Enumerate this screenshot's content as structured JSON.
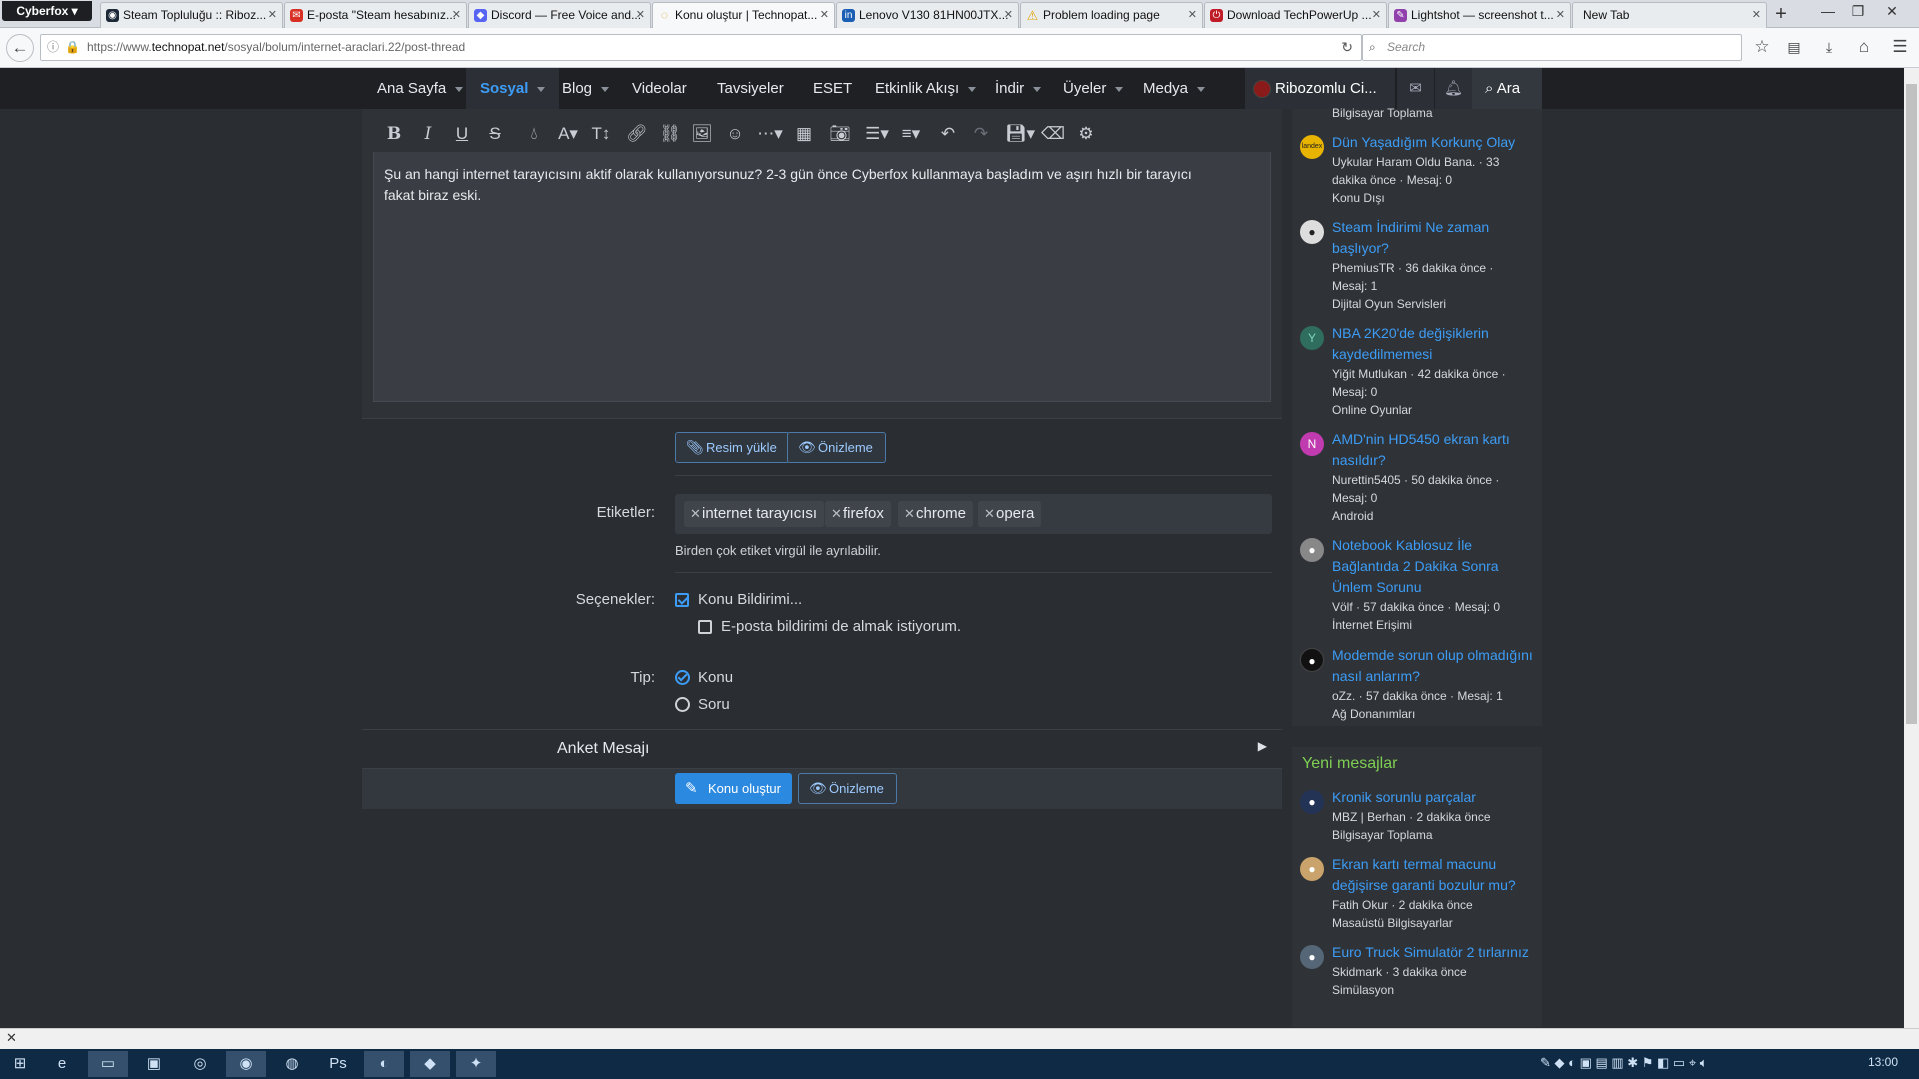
{
  "browser": {
    "app_menu": "Cyberfox",
    "tabs": [
      {
        "title": "Steam Topluluğu :: Riboz...",
        "icon": "steam-icon",
        "color": "#1b2838"
      },
      {
        "title": "E-posta \"Steam hesabınız...",
        "icon": "mail-icon",
        "color": "#d93025"
      },
      {
        "title": "Discord — Free Voice and...",
        "icon": "discord-icon",
        "color": "#5865f2"
      },
      {
        "title": "Konu oluştur | Technopat...",
        "icon": "loading-icon",
        "color": "#e0a020"
      },
      {
        "title": "Lenovo V130 81HN00JTX...",
        "icon": "lenovo-icon",
        "color": "#1a5fb4"
      },
      {
        "title": "Problem loading page",
        "icon": "warning-icon",
        "color": "#e5a50a"
      },
      {
        "title": "Download TechPowerUp ...",
        "icon": "techpowerup-icon",
        "color": "#c01c28"
      },
      {
        "title": "Lightshot — screenshot t...",
        "icon": "lightshot-icon",
        "color": "#9141ac"
      },
      {
        "title": "New Tab",
        "icon": "",
        "color": ""
      }
    ],
    "url_prefix": "https://www.",
    "url_domain": "technopat.net",
    "url_path": "/sosyal/bolum/internet-araclari.22/post-thread",
    "search_placeholder": "Search"
  },
  "site": {
    "nav": [
      {
        "label": "Ana Sayfa",
        "caret": true
      },
      {
        "label": "Sosyal",
        "caret": true,
        "active": true
      },
      {
        "label": "Blog",
        "caret": true
      },
      {
        "label": "Videolar",
        "caret": false
      },
      {
        "label": "Tavsiyeler",
        "caret": false
      },
      {
        "label": "ESET",
        "caret": false
      },
      {
        "label": "Etkinlik Akışı",
        "caret": true
      },
      {
        "label": "İndir",
        "caret": true
      },
      {
        "label": "Üyeler",
        "caret": true
      },
      {
        "label": "Medya",
        "caret": true
      }
    ],
    "username": "Ribozomlu Ci...",
    "search_label": "Ara"
  },
  "editor": {
    "text_part1": "Şu an hangi internet tarayıcısını aktif olarak kullanıyorsunuz? 2-3 gün önce Cyberfox kullanmaya başladım ve aşırı hızlı bir tarayıcı",
    "text_part2": "fakat biraz eski."
  },
  "form": {
    "upload_btn": "Resim yükle",
    "preview_btn": "Önizleme",
    "tags_label": "Etiketler:",
    "tags": [
      "internet tarayıcısı",
      "firefox",
      "chrome",
      "opera"
    ],
    "tags_hint": "Birden çok etiket virgül ile ayrılabilir.",
    "options_label": "Seçenekler:",
    "opt_watch": "Konu Bildirimi...",
    "opt_email": "E-posta bildirimi de almak istiyorum.",
    "type_label": "Tip:",
    "type_konu": "Konu",
    "type_soru": "Soru",
    "poll_title": "Anket Mesajı",
    "submit_btn": "Konu oluştur",
    "preview_btn2": "Önizleme"
  },
  "sidebar": {
    "top_fragment": "Bilgisayar Toplama",
    "items": [
      {
        "title": "Dün Yaşadığım Korkunç Olay",
        "meta": [
          "Uykular Haram Oldu Bana. · 33",
          "dakika önce · Mesaj: 0",
          "Konu Dışı"
        ],
        "avatar": "landex",
        "color": "#e8b400"
      },
      {
        "title": "Steam İndirimi Ne zaman başlıyor?",
        "meta": [
          "PhemiusTR · 36 dakika önce ·",
          "Mesaj: 1",
          "Dijital Oyun Servisleri"
        ],
        "avatar": "",
        "color": "#dddddd"
      },
      {
        "title": "NBA 2K20'de değişiklerin kaydedilmemesi",
        "meta": [
          "Yiğit Mutlukan · 42 dakika önce ·",
          "Mesaj: 0",
          "Online Oyunlar"
        ],
        "avatar": "Y",
        "color": "#2f6d5e"
      },
      {
        "title": "AMD'nin HD5450 ekran kartı nasıldır?",
        "meta": [
          "Nurettin5405 · 50 dakika önce ·",
          "Mesaj: 0",
          "Android"
        ],
        "avatar": "N",
        "color": "#c13bb0"
      },
      {
        "title": "Notebook Kablosuz İle Bağlantıda 2 Dakika Sonra Ünlem Sorunu",
        "meta": [
          "Völf · 57 dakika önce · Mesaj: 0",
          "İnternet Erişimi"
        ],
        "avatar": "",
        "color": "#888888"
      },
      {
        "title": "Modemde sorun olup olmadığını nasıl anlarım?",
        "meta": [
          "oZz. · 57 dakika önce · Mesaj: 1",
          "Ağ Donanımları"
        ],
        "avatar": "",
        "color": "#111111"
      }
    ],
    "new_title": "Yeni mesajlar",
    "new_items": [
      {
        "title": "Kronik sorunlu parçalar",
        "meta": [
          "MBZ | Berhan · 2 dakika önce",
          "Bilgisayar Toplama"
        ],
        "color": "#223355"
      },
      {
        "title": "Ekran kartı termal macunu değişirse garanti bozulur mu?",
        "meta": [
          "Fatih Okur · 2 dakika önce",
          "Masaüstü Bilgisayarlar"
        ],
        "color": "#c9a36b"
      },
      {
        "title": "Euro Truck Simulatör 2 tırlarınız",
        "meta": [
          "Skidmark · 3 dakika önce",
          "Simülasyon"
        ],
        "color": "#556677"
      }
    ]
  },
  "taskbar": {
    "time": "13:00"
  },
  "colors": {
    "accent": "#3d9cf5",
    "submit": "#2b8ae0",
    "new_posts": "#7fcf52"
  }
}
